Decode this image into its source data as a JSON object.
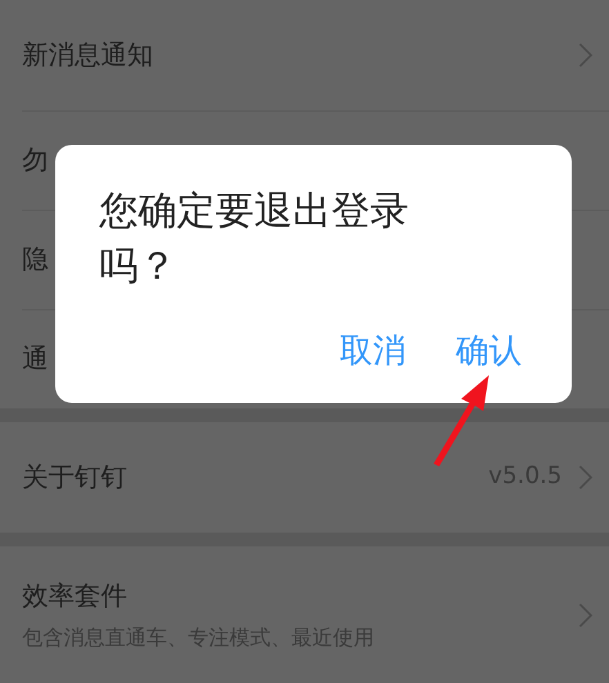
{
  "sections": [
    {
      "items": [
        {
          "label": "新消息通知",
          "chevron": true
        },
        {
          "label": "勿",
          "chevron": false
        },
        {
          "label": "隐",
          "chevron": false
        },
        {
          "label": "通",
          "chevron": false
        }
      ]
    },
    {
      "items": [
        {
          "label": "关于钉钉",
          "value": "v5.0.5",
          "chevron": true
        }
      ]
    },
    {
      "items": [
        {
          "label": "效率套件",
          "subtitle": "包含消息直通车、专注模式、最近使用",
          "chevron": true
        }
      ]
    }
  ],
  "dialog": {
    "message": "您确定要退出登录吗？",
    "buttons": [
      {
        "label": "取消"
      },
      {
        "label": "确认"
      }
    ]
  }
}
